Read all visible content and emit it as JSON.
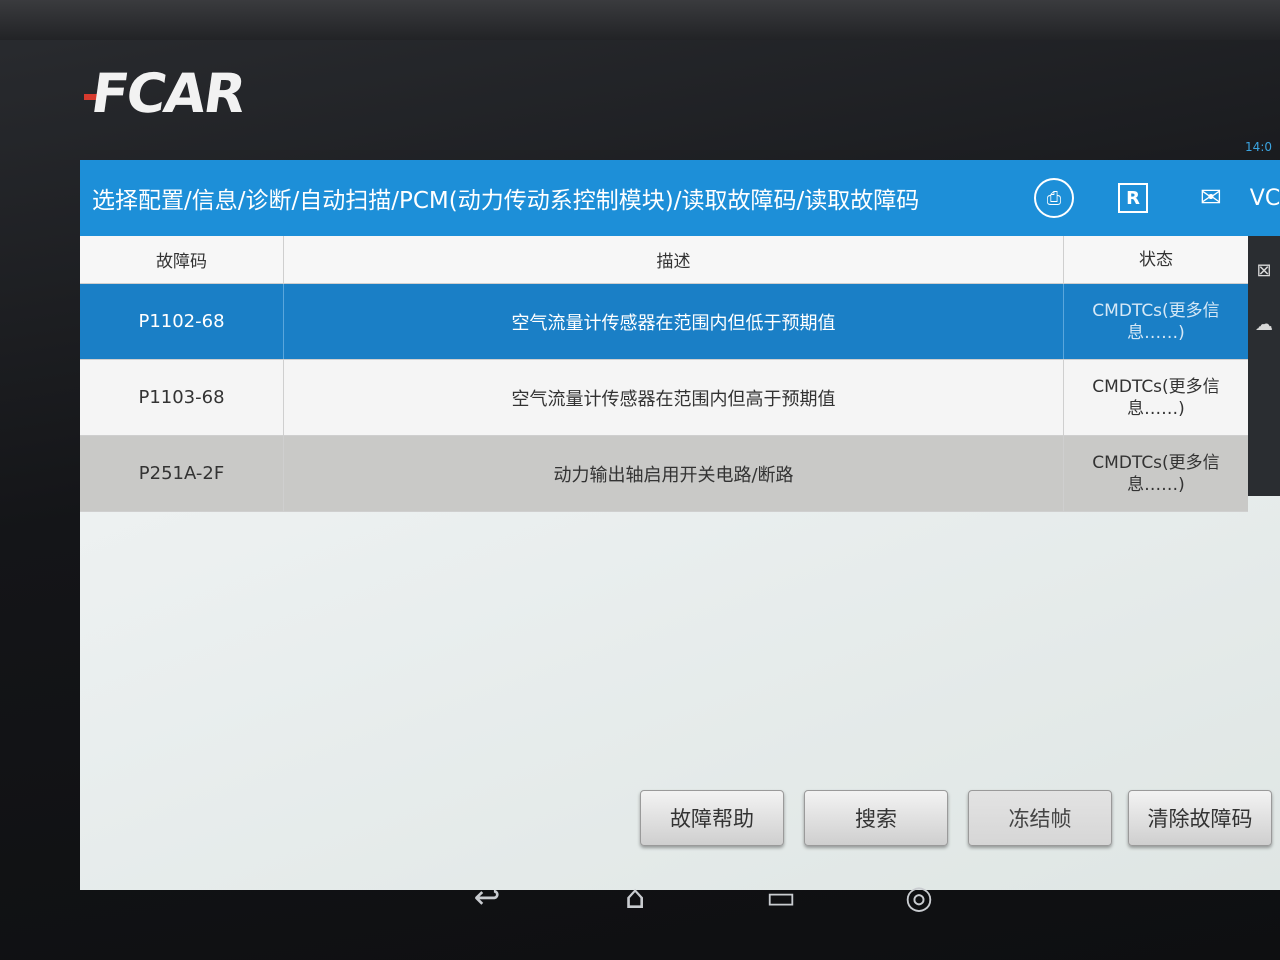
{
  "brand": {
    "logo_text": "FCAR"
  },
  "status": {
    "time": "14:0"
  },
  "titlebar": {
    "breadcrumb": "选择配置/信息/诊断/自动扫描/PCM(动力传动系控制模块)/读取故障码/读取故障码",
    "icons": [
      "print-icon",
      "report-icon",
      "mail-icon"
    ],
    "report_glyph": "R",
    "vci_label": "VCI"
  },
  "table": {
    "columns": [
      "故障码",
      "描述",
      "状态"
    ],
    "rows": [
      {
        "code": "P1102-68",
        "description": "空气流量计传感器在范围内但低于预期值",
        "status": "CMDTCs(更多信息……)"
      },
      {
        "code": "P1103-68",
        "description": "空气流量计传感器在范围内但高于预期值",
        "status": "CMDTCs(更多信息……)"
      },
      {
        "code": "P251A-2F",
        "description": "动力输出轴启用开关电路/断路",
        "status": "CMDTCs(更多信息……)"
      }
    ]
  },
  "buttons": {
    "help": "故障帮助",
    "search": "搜索",
    "freeze": "冻结帧",
    "clear": "清除故障码"
  },
  "navbar": {
    "icons": [
      "back-icon",
      "home-icon",
      "recent-apps-icon",
      "browser-icon"
    ]
  },
  "colors": {
    "titlebar": "#1d8fd8",
    "selected_row": "#1a7fc6",
    "logo_accent": "#d63a2e"
  }
}
